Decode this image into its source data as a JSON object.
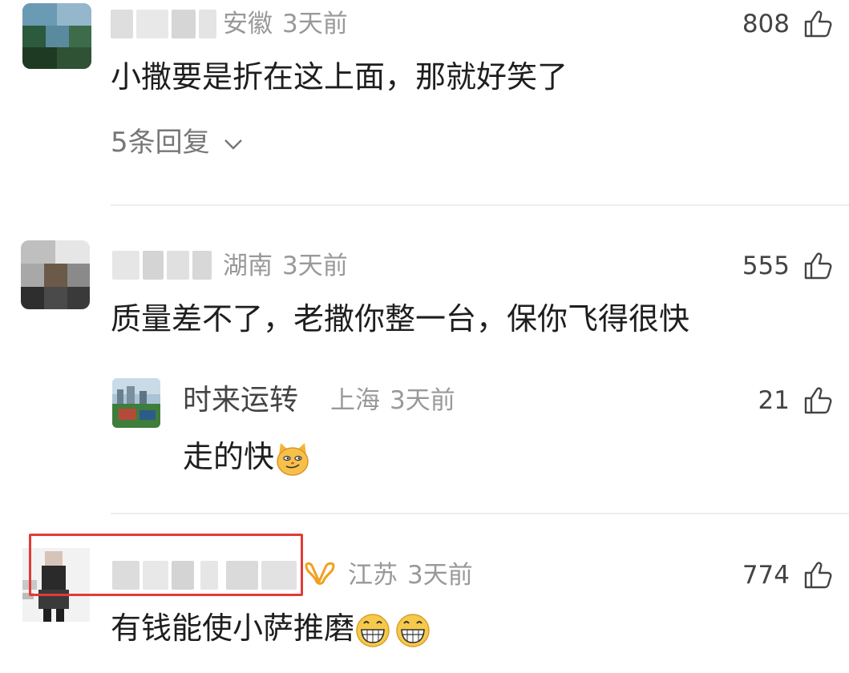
{
  "comments": [
    {
      "region": "安徽",
      "time": "3天前",
      "likes": "808",
      "text": "小撒要是折在这上面，那就好笑了",
      "replies_label": "5条回复"
    },
    {
      "region": "湖南",
      "time": "3天前",
      "likes": "555",
      "text": "质量差不了，老撒你整一台，保你飞得很快",
      "reply": {
        "name": "时来运转",
        "region": "上海",
        "time": "3天前",
        "likes": "21",
        "text": "走的快",
        "emoji": "smirk-cat-emoji"
      }
    },
    {
      "region": "江苏",
      "time": "3天前",
      "likes": "774",
      "text": "有钱能使小萨推磨",
      "emojis": [
        "grinning-emoji",
        "grinning-emoji"
      ],
      "badge": "vip-badge-icon"
    }
  ],
  "icons": {
    "like": "thumbs-up-icon",
    "expand": "chevron-down-icon"
  },
  "colors": {
    "highlight": "#e23b36",
    "badge": "#f0a020",
    "meta": "#999999"
  }
}
